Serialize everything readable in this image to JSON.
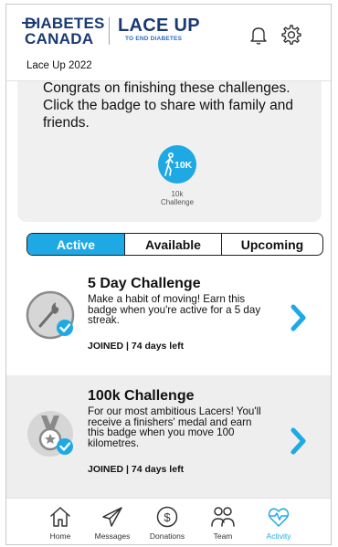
{
  "header": {
    "brand_line1": "DIABETES",
    "brand_line2": "CANADA",
    "campaign_line1": "LACE UP",
    "campaign_line2": "TO END DIABETES",
    "page_subtitle": "Lace Up 2022",
    "icons": [
      "bell-icon",
      "gear-icon"
    ]
  },
  "congrats": {
    "text": "Congrats on finishing these challenges. Click the badge to share with family and friends.",
    "badge": {
      "icon_text": "10K",
      "label_line1": "10k",
      "label_line2": "Challenge"
    }
  },
  "tabs": [
    {
      "label": "Active",
      "active": true
    },
    {
      "label": "Available",
      "active": false
    },
    {
      "label": "Upcoming",
      "active": false
    }
  ],
  "challenges": [
    {
      "title": "5 Day Challenge",
      "description": "Make a habit of moving! Earn this badge when you're active for a 5 day streak.",
      "status": "JOINED | 74 days left",
      "icon": "torch-badge-icon"
    },
    {
      "title": "100k Challenge",
      "description": "For our most ambitious Lacers! You'll receive a finishers' medal and earn this badge when you move 100 kilometres.",
      "status": "JOINED | 74 days left",
      "icon": "medal-badge-icon"
    }
  ],
  "bottom_nav": [
    {
      "label": "Home",
      "icon": "home-icon",
      "active": false
    },
    {
      "label": "Messages",
      "icon": "send-icon",
      "active": false
    },
    {
      "label": "Donations",
      "icon": "dollar-icon",
      "active": false
    },
    {
      "label": "Team",
      "icon": "team-icon",
      "active": false
    },
    {
      "label": "Activity",
      "icon": "heartbeat-icon",
      "active": true
    }
  ],
  "colors": {
    "accent": "#1ea9e5",
    "brand_navy": "#1a3a73",
    "card_gray": "#f0f0f0"
  }
}
